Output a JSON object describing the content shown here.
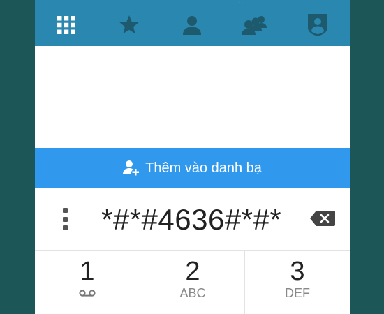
{
  "status_bar": {
    "dots": "..."
  },
  "tabs": [
    {
      "name": "keypad",
      "icon": "keypad-icon"
    },
    {
      "name": "favorites",
      "icon": "star-icon"
    },
    {
      "name": "contacts",
      "icon": "contact-icon"
    },
    {
      "name": "groups",
      "icon": "group-icon"
    },
    {
      "name": "profile",
      "icon": "profile-badge-icon"
    }
  ],
  "add_contact": {
    "label": "Thêm vào danh bạ",
    "icon": "add-contact-icon"
  },
  "dial_input": {
    "value": "*#*#4636#*#*"
  },
  "keys": [
    {
      "digit": "1",
      "letters": "",
      "icon": "voicemail-icon"
    },
    {
      "digit": "2",
      "letters": "ABC"
    },
    {
      "digit": "3",
      "letters": "DEF"
    }
  ],
  "colors": {
    "top_bar": "#2a87b0",
    "accent_bar": "#3099ee",
    "icon_dark": "#1e5a6e",
    "background": "#1d5656"
  }
}
